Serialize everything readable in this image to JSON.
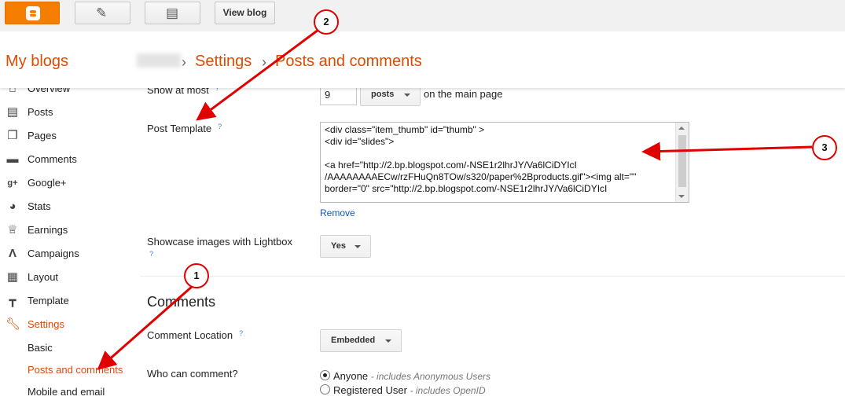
{
  "toolbar": {
    "view_blog_label": "View blog",
    "icons": [
      "blogger-logo-icon",
      "pencil-icon",
      "posts-list-icon"
    ]
  },
  "header": {
    "my_blogs": "My blogs",
    "crumb_settings": "Settings",
    "crumb_separator": "›",
    "crumb_current": "Posts and comments"
  },
  "sidebar": {
    "items": [
      {
        "label": "Overview",
        "icon": "home-icon"
      },
      {
        "label": "Posts",
        "icon": "posts-icon"
      },
      {
        "label": "Pages",
        "icon": "pages-icon"
      },
      {
        "label": "Comments",
        "icon": "comment-icon"
      },
      {
        "label": "Google+",
        "icon": "google-plus-icon"
      },
      {
        "label": "Stats",
        "icon": "stats-pie-icon"
      },
      {
        "label": "Earnings",
        "icon": "trophy-icon"
      },
      {
        "label": "Campaigns",
        "icon": "campaigns-icon"
      },
      {
        "label": "Layout",
        "icon": "layout-icon"
      },
      {
        "label": "Template",
        "icon": "paint-roller-icon"
      },
      {
        "label": "Settings",
        "icon": "wrench-icon"
      }
    ],
    "sub_items": [
      "Basic",
      "Posts and comments",
      "Mobile and email"
    ]
  },
  "posts": {
    "show_at_most_label": "Show at most",
    "count_value": "9",
    "unit_dropdown": "posts",
    "suffix": "on the main page",
    "post_template_label": "Post Template",
    "template_lines": [
      "<div class=\"item_thumb\" id=\"thumb\" >",
      "<div id=\"slides\">",
      "",
      "<a href=\"http://2.bp.blogspot.com/-NSE1r2lhrJY/Va6lCiDYIcI",
      "/AAAAAAAAECw/rzFHuQn8TOw/s320/paper%2Bproducts.gif\"><img alt=\"\"",
      "border=\"0\" src=\"http://2.bp.blogspot.com/-NSE1r2lhrJY/Va6lCiDYIcI"
    ],
    "remove_link": "Remove",
    "lightbox_label": "Showcase images with Lightbox",
    "lightbox_value": "Yes"
  },
  "comments": {
    "section_title": "Comments",
    "location_label": "Comment Location",
    "location_value": "Embedded",
    "who_label": "Who can comment?",
    "options": [
      {
        "label": "Anyone",
        "note": "- includes Anonymous Users",
        "checked": true
      },
      {
        "label": "Registered User",
        "note": "- includes OpenID",
        "checked": false
      }
    ]
  },
  "help_mark": "?",
  "annotations": [
    "1",
    "2",
    "3"
  ],
  "colors": {
    "accent": "#dd4b00",
    "annotation": "#e00000",
    "link": "#1155cc"
  }
}
